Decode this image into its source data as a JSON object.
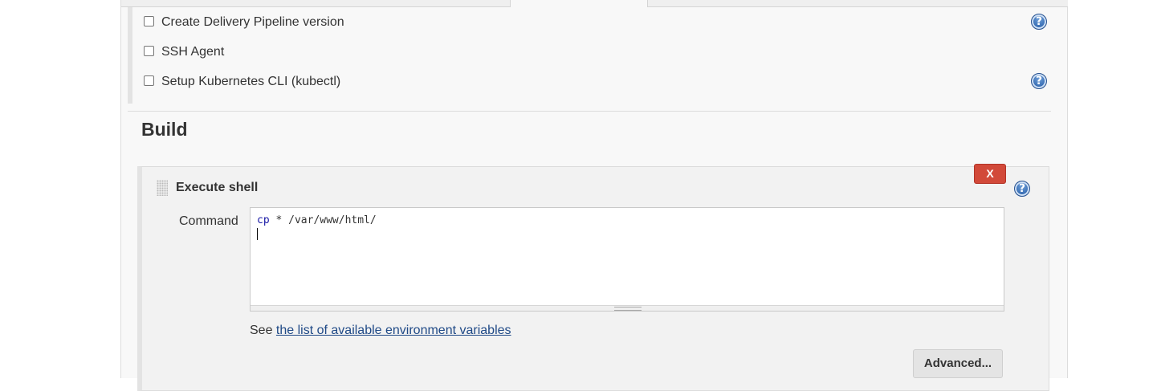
{
  "wrappers": [
    {
      "label": "Create Delivery Pipeline version",
      "checked": false,
      "has_help": true
    },
    {
      "label": "SSH Agent",
      "checked": false,
      "has_help": false
    },
    {
      "label": "Setup Kubernetes CLI (kubectl)",
      "checked": false,
      "has_help": true
    }
  ],
  "build": {
    "title": "Build",
    "step": {
      "title": "Execute shell",
      "delete_label": "X",
      "command_label": "Command",
      "command": {
        "keyword": "cp",
        "rest": " * /var/www/html/"
      },
      "env_prefix": "See ",
      "env_link": "the list of available environment variables",
      "advanced_label": "Advanced..."
    }
  },
  "icons": {
    "help": "help-icon",
    "drag": "drag-handle-icon"
  },
  "colors": {
    "delete": "#d24939",
    "help": "#3a6fb5",
    "link": "#204a87"
  }
}
